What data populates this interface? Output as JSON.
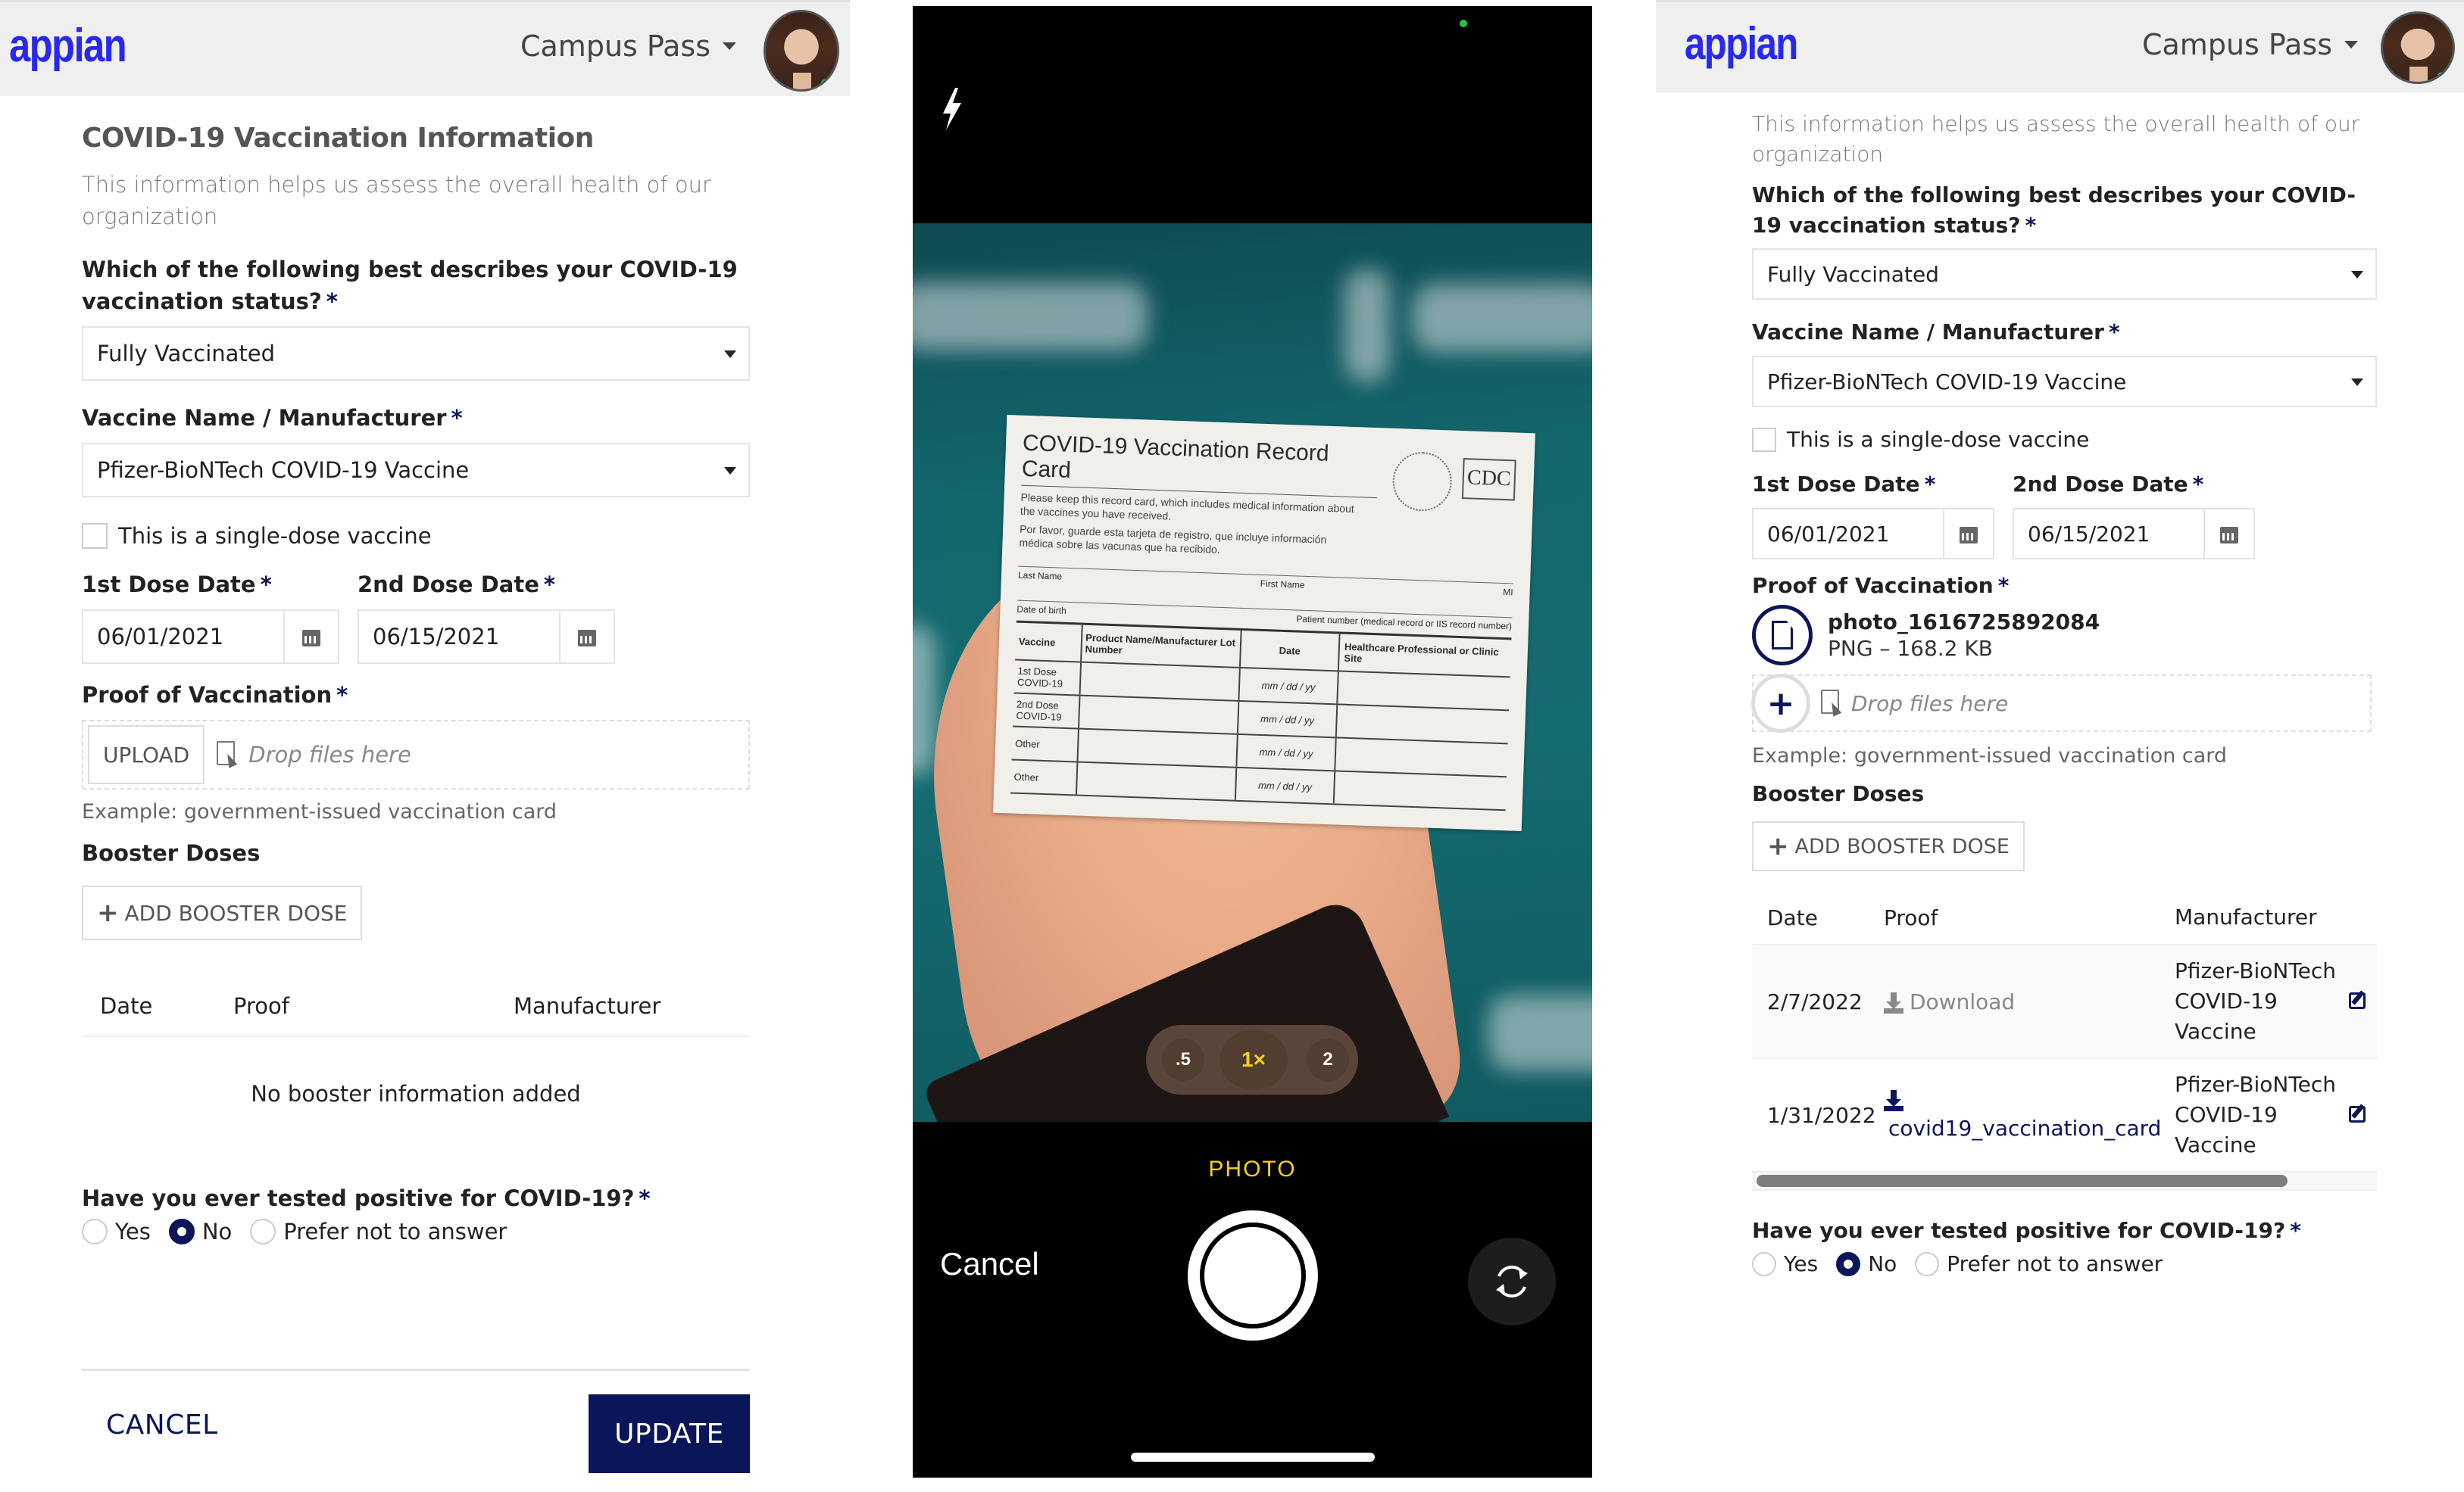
{
  "app": {
    "logo_text": "appian",
    "site_name": "Campus Pass",
    "brand_color": "#2828f0",
    "accent_color": "#0b1559"
  },
  "left_form": {
    "title": "COVID-19 Vaccination Information",
    "instructions": "This information helps us assess the overall health of our organization",
    "status_label": "Which of the following best describes your COVID-19 vaccination status?",
    "status_value": "Fully Vaccinated",
    "vaccine_label": "Vaccine Name / Manufacturer",
    "vaccine_value": "Pfizer-BioNTech COVID-19 Vaccine",
    "single_dose_label": "This is a single-dose vaccine",
    "single_dose_checked": false,
    "dose1_label": "1st Dose Date",
    "dose1_value": "06/01/2021",
    "dose2_label": "2nd Dose Date",
    "dose2_value": "06/15/2021",
    "proof_label": "Proof of Vaccination",
    "upload_button": "UPLOAD",
    "drop_text": "Drop files here",
    "proof_helper": "Example: government-issued vaccination card",
    "booster_label": "Booster Doses",
    "add_booster_button": "ADD BOOSTER DOSE",
    "booster_columns": [
      "Date",
      "Proof",
      "Manufacturer"
    ],
    "booster_empty": "No booster information added",
    "positive_label": "Have you ever tested positive for COVID-19?",
    "positive_options": [
      "Yes",
      "No",
      "Prefer not to answer"
    ],
    "positive_selected": "No",
    "required_marker": "*",
    "cancel_button": "CANCEL",
    "update_button": "UPDATE"
  },
  "camera": {
    "card_title": "COVID-19 Vaccination Record Card",
    "card_text_en": "Please keep this record card, which includes medical information about the vaccines you have received.",
    "card_text_es": "Por favor, guarde esta tarjeta de registro, que incluye información médica sobre las vacunas que ha recibido.",
    "card_logo": "CDC",
    "card_fields": [
      "Last Name",
      "First Name",
      "MI"
    ],
    "card_fields2": [
      "Date of birth",
      "Patient number (medical record or IIS record number)"
    ],
    "card_headers": [
      "Vaccine",
      "Product Name/Manufacturer Lot Number",
      "Date",
      "Healthcare Professional or Clinic Site"
    ],
    "card_rows": [
      "1st Dose COVID-19",
      "2nd Dose COVID-19",
      "Other",
      "Other"
    ],
    "card_date_placeholder": "mm / dd / yy",
    "zoom_options": [
      ".5",
      "1×",
      "2"
    ],
    "zoom_selected": "1×",
    "mode": "PHOTO",
    "cancel": "Cancel"
  },
  "right_form": {
    "instructions": "This information helps us assess the overall health of our organization",
    "status_label": "Which of the following best describes your COVID-19 vaccination status?",
    "status_value": "Fully Vaccinated",
    "vaccine_label": "Vaccine Name / Manufacturer",
    "vaccine_value": "Pfizer-BioNTech COVID-19 Vaccine",
    "single_dose_label": "This is a single-dose vaccine",
    "single_dose_checked": false,
    "dose1_label": "1st Dose Date",
    "dose1_value": "06/01/2021",
    "dose2_label": "2nd Dose Date",
    "dose2_value": "06/15/2021",
    "proof_label": "Proof of Vaccination",
    "file_name": "photo_1616725892084",
    "file_meta": "PNG – 168.2 KB",
    "drop_text": "Drop files here",
    "proof_helper": "Example: government-issued vaccination card",
    "booster_label": "Booster Doses",
    "add_booster_button": "ADD BOOSTER DOSE",
    "booster_columns": [
      "Date",
      "Proof",
      "Manufacturer"
    ],
    "booster_rows": [
      {
        "date": "2/7/2022",
        "proof": "Download",
        "manufacturer": "Pfizer-BioNTech COVID-19 Vaccine"
      },
      {
        "date": "1/31/2022",
        "proof": "covid19_vaccination_card",
        "manufacturer": "Pfizer-BioNTech COVID-19 Vaccine"
      }
    ],
    "scroll_fraction_visible": 0.85,
    "positive_label": "Have you ever tested positive for COVID-19?",
    "positive_options": [
      "Yes",
      "No",
      "Prefer not to answer"
    ],
    "positive_selected": "No",
    "required_marker": "*"
  }
}
